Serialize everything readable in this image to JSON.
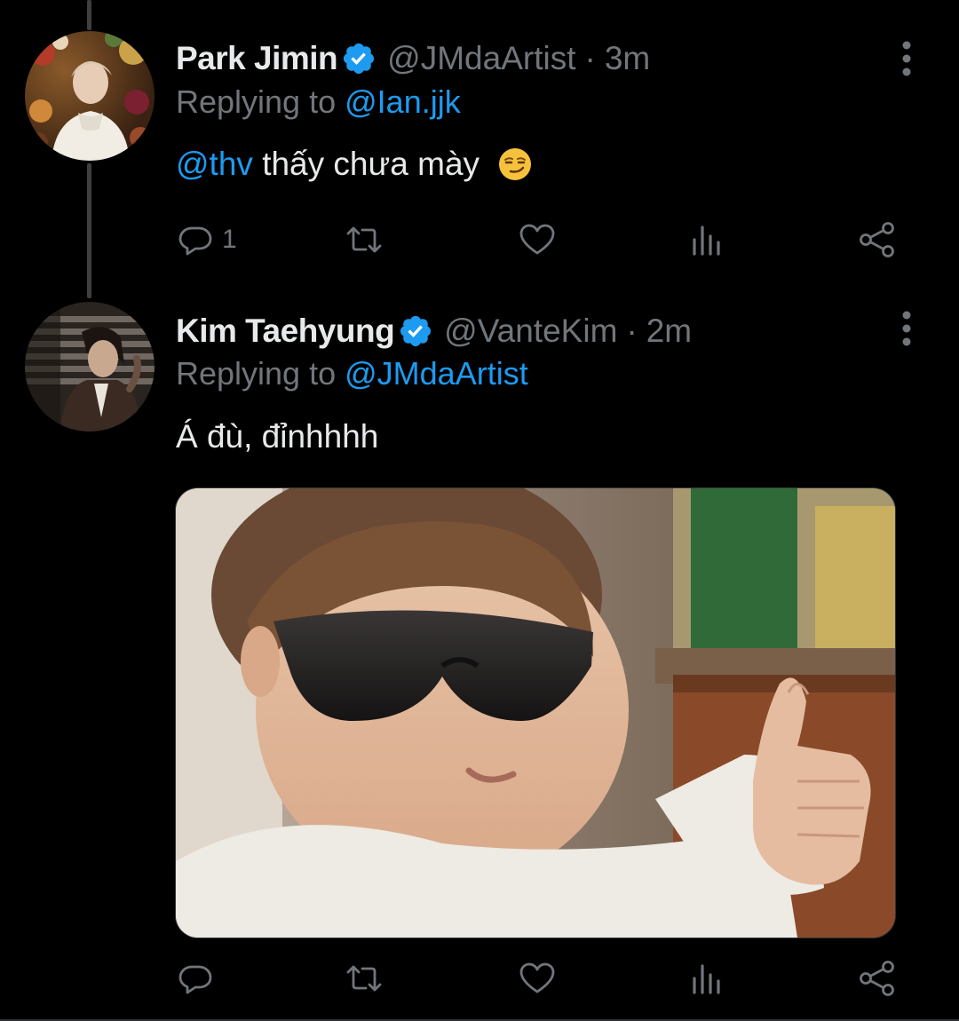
{
  "tweets": [
    {
      "display_name": "Park Jimin",
      "handle": "@JMdaArtist",
      "separator": "·",
      "time": "3m",
      "reply_prefix": "Replying to",
      "reply_to": "@Ian.jjk",
      "mention": "@thv",
      "text": "thấy chưa mày",
      "emoji": "smirking-face-emoji",
      "actions": {
        "reply_count": "1"
      }
    },
    {
      "display_name": "Kim Taehyung",
      "handle": "@VanteKim",
      "separator": "·",
      "time": "2m",
      "reply_prefix": "Replying to",
      "reply_to": "@JMdaArtist",
      "text": "Á đù, đỉnhhhh",
      "media": "photo",
      "actions": {
        "reply_count": ""
      }
    }
  ],
  "icons": {
    "verified": "verified-badge-icon",
    "more": "more-vertical-icon",
    "reply": "reply-icon",
    "retweet": "retweet-icon",
    "like": "heart-icon",
    "views": "analytics-icon",
    "share": "share-icon"
  },
  "colors": {
    "background": "#000000",
    "text": "#e7e9ea",
    "secondary": "#71767b",
    "accent": "#1d9bf0"
  }
}
